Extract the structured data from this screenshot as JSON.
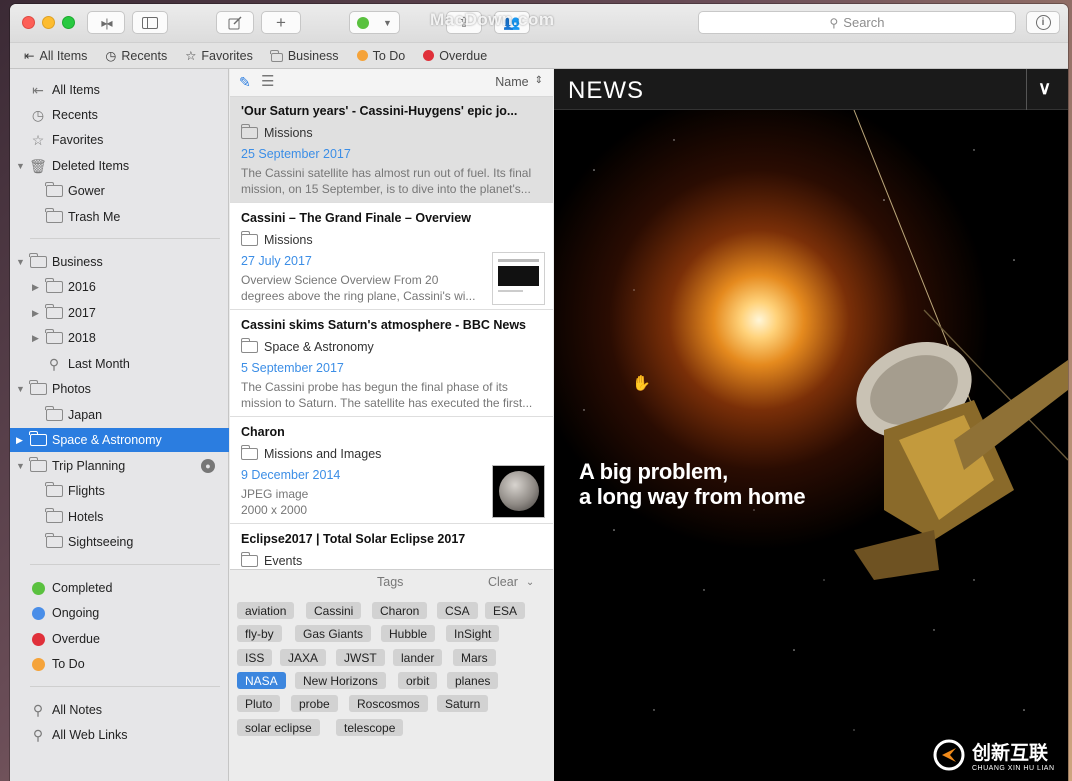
{
  "watermark_top": "MacDown.com",
  "toolbar": {
    "search_placeholder": "Search"
  },
  "favorites_bar": [
    {
      "label": "All Items",
      "icon": "all-items-icon"
    },
    {
      "label": "Recents",
      "icon": "clock-icon"
    },
    {
      "label": "Favorites",
      "icon": "star-icon"
    },
    {
      "label": "Business",
      "icon": "folder-icon"
    },
    {
      "label": "To Do",
      "color": "#f5a33a"
    },
    {
      "label": "Overdue",
      "color": "#e0303a"
    }
  ],
  "sidebar": {
    "items": [
      {
        "label": "All Items"
      },
      {
        "label": "Recents"
      },
      {
        "label": "Favorites"
      },
      {
        "label": "Deleted Items"
      },
      {
        "label": "Gower"
      },
      {
        "label": "Trash Me"
      },
      {
        "label": "Business"
      },
      {
        "label": "2016"
      },
      {
        "label": "2017"
      },
      {
        "label": "2018"
      },
      {
        "label": "Last Month"
      },
      {
        "label": "Photos"
      },
      {
        "label": "Japan"
      },
      {
        "label": "Space & Astronomy"
      },
      {
        "label": "Trip Planning"
      },
      {
        "label": "Flights"
      },
      {
        "label": "Hotels"
      },
      {
        "label": "Sightseeing"
      },
      {
        "label": "Completed",
        "color": "#5ac13f"
      },
      {
        "label": "Ongoing",
        "color": "#4a8ee8"
      },
      {
        "label": "Overdue",
        "color": "#e0303a"
      },
      {
        "label": "To Do",
        "color": "#f5a33a"
      },
      {
        "label": "All Notes"
      },
      {
        "label": "All Web Links"
      }
    ]
  },
  "list": {
    "sort_label": "Name",
    "notes": [
      {
        "title": "'Our Saturn years' - Cassini-Huygens' epic jo...",
        "folder": "Missions",
        "date": "25 September 2017",
        "summary": "The Cassini satellite has almost run out of fuel. Its final mission, on 15 September, is to dive into the planet's..."
      },
      {
        "title": "Cassini – The Grand Finale – Overview",
        "folder": "Missions",
        "date": "27 July 2017",
        "summary": "Overview Science Overview From 20 degrees above the ring plane, Cassini's wi..."
      },
      {
        "title": "Cassini skims Saturn's atmosphere - BBC News",
        "folder": "Space & Astronomy",
        "date": "5 September 2017",
        "summary": "The Cassini probe has begun the final phase of its mission to Saturn. The satellite has executed the first..."
      },
      {
        "title": "Charon",
        "folder": "Missions and Images",
        "date": "9 December 2014",
        "summary": "JPEG image",
        "dimensions": "2000 x 2000"
      },
      {
        "title": "Eclipse2017 | Total Solar Eclipse 2017",
        "folder": "Events"
      }
    ]
  },
  "tags": {
    "title": "Tags",
    "clear_label": "Clear",
    "items": [
      "aviation",
      "Cassini",
      "Charon",
      "CSA",
      "ESA",
      "fly-by",
      "Gas Giants",
      "Hubble",
      "InSight",
      "ISS",
      "JAXA",
      "JWST",
      "lander",
      "Mars",
      "NASA",
      "New Horizons",
      "orbit",
      "planes",
      "Pluto",
      "probe",
      "Roscosmos",
      "Saturn",
      "solar eclipse",
      "telescope"
    ],
    "selected": "NASA"
  },
  "preview": {
    "section_title": "NEWS",
    "headline_line1": "A big problem,",
    "headline_line2": "a long way from home"
  },
  "watermark_bottom": {
    "cn": "创新互联",
    "en": "CHUANG XIN HU LIAN"
  }
}
